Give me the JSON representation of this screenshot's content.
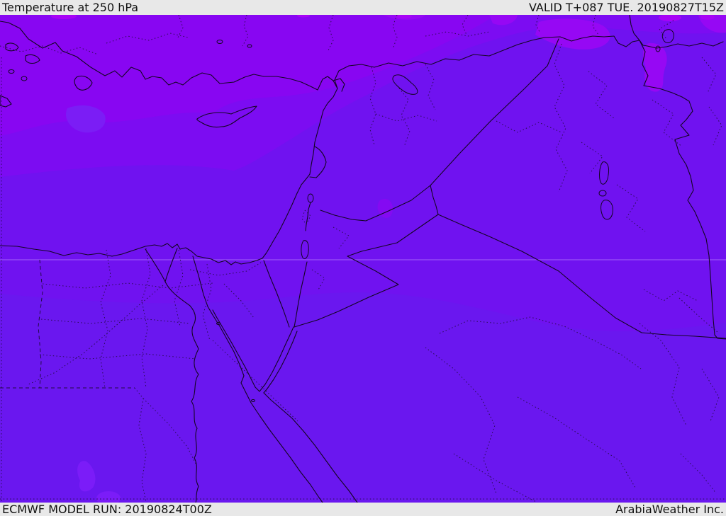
{
  "header": {
    "title": "Temperature at 250 hPa",
    "valid": "VALID T+087 TUE. 20190827T15Z"
  },
  "footer": {
    "model_run": "ECMWF MODEL RUN: 20190824T00Z",
    "provider": "ArabiaWeather Inc."
  },
  "map": {
    "parameter": "Temperature",
    "level": "250 hPa",
    "model": "ECMWF",
    "run_time": "20190824T00Z",
    "valid_step": "T+087",
    "valid_time": "TUE. 20190827T15Z",
    "region": "Eastern Mediterranean / Middle East"
  },
  "palette": {
    "bar_bg": "#e8e8e8",
    "bar_text": "#111111",
    "base_purple": "#7012f0",
    "north_violet": "#8806f2",
    "northeast_violet": "#7c0cf2",
    "bright_patch": "#9608f4",
    "magenta_patch": "#a704f6",
    "south_blue_purple": "#6a17ef",
    "south_patch": "#7b1cf8",
    "jordan_patch": "#840af2",
    "west_med_patch": "#7b1df5",
    "border_line": "#140522",
    "admin_dotted": "#1c0a33",
    "graticule": "#e3c8ff"
  }
}
